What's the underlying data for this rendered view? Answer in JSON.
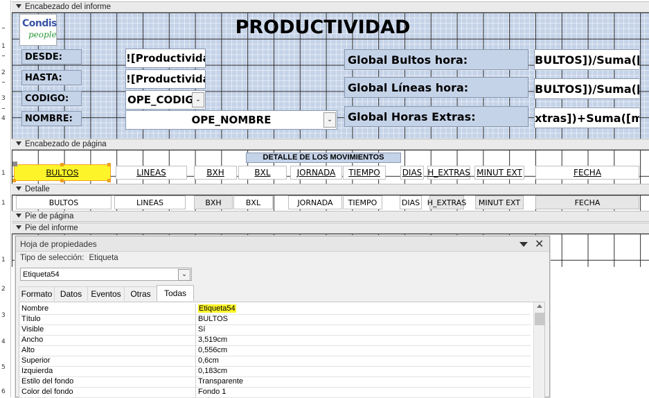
{
  "ruler": {
    "marks": [
      "1",
      "2",
      "3",
      "4",
      "1",
      "1",
      "1",
      "2",
      "3",
      "4",
      "5",
      "6"
    ]
  },
  "sections": {
    "report_header": "Encabezado del informe",
    "page_header": "Encabezado de página",
    "detail": "Detalle",
    "page_footer": "Pie de página",
    "report_footer": "Pie del informe"
  },
  "logo": {
    "line1": "Condis",
    "line2": "people"
  },
  "report_header": {
    "title": "PRODUCTIVIDAD",
    "desde_label": "DESDE:",
    "hasta_label": "HASTA:",
    "codigo_label": "CODIGO:",
    "nombre_label": "NOMBRE:",
    "desde_value": "![Productivida",
    "hasta_value": "![Productivida",
    "codigo_value": "OPE_CODIGO",
    "nombre_value": "OPE_NOMBRE",
    "global_bultos_label": "Global Bultos hora:",
    "global_lineas_label": "Global Líneas hora:",
    "global_horas_label": "Global Horas Extras:",
    "global_bultos_value": "BULTOS])/Suma([T",
    "global_lineas_value": "BULTOS])/Suma([",
    "global_horas_value": "xtras])+Suma([mi"
  },
  "page_header": {
    "group_title": "DETALLE DE LOS MOVIMIENTOS",
    "columns": [
      "BULTOS",
      "LINEAS",
      "BXH",
      "BXL",
      "JORNADA",
      "TIEMPO",
      "DIAS",
      "H_EXTRAS",
      "MINUT EXT",
      "FECHA"
    ]
  },
  "detail": {
    "fields": [
      "BULTOS",
      "LINEAS",
      "BXH",
      "BXL",
      "JORNADA",
      "TIEMPO",
      "DIAS",
      "H_EXTRAS",
      "MINUT EXT",
      "FECHA"
    ]
  },
  "property_sheet": {
    "title": "Hoja de propiedades",
    "selection_type_label": "Tipo de selección:",
    "selection_type_value": "Etiqueta",
    "selected_object": "Etiqueta54",
    "tabs": [
      "Formato",
      "Datos",
      "Eventos",
      "Otras",
      "Todas"
    ],
    "active_tab": "Todas",
    "rows": [
      {
        "name": "Nombre",
        "value": "Etiqueta54"
      },
      {
        "name": "Título",
        "value": "BULTOS"
      },
      {
        "name": "Visible",
        "value": "Sí"
      },
      {
        "name": "Ancho",
        "value": "3,519cm"
      },
      {
        "name": "Alto",
        "value": "0,556cm"
      },
      {
        "name": "Superior",
        "value": "0,6cm"
      },
      {
        "name": "Izquierda",
        "value": "0,183cm"
      },
      {
        "name": "Estilo del fondo",
        "value": "Transparente"
      },
      {
        "name": "Color del fondo",
        "value": "Fondo 1"
      }
    ]
  },
  "colors": {
    "design_blue": "#c5d3e8",
    "highlight_yellow": "#fdf52a",
    "selection_orange": "#f0a020"
  }
}
